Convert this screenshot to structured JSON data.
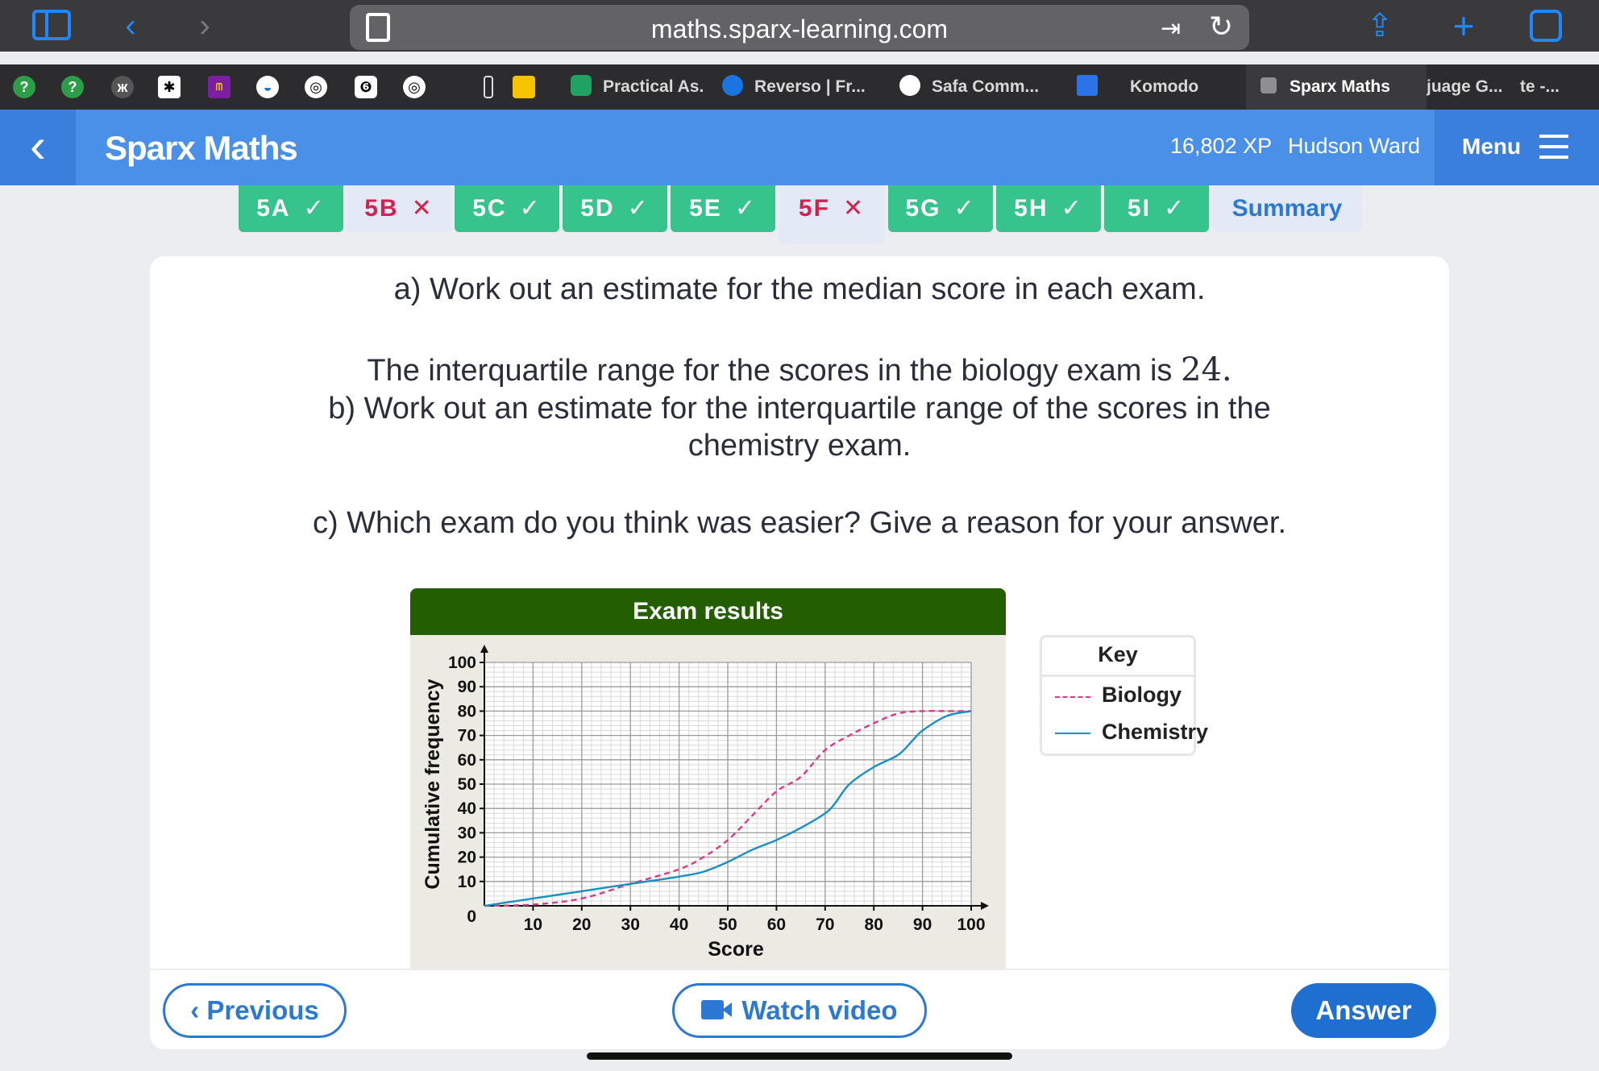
{
  "browser": {
    "url": "maths.sparx-learning.com",
    "tabs": [
      {
        "label": "Practical As."
      },
      {
        "label": "Reverso | Fr..."
      },
      {
        "label": "Safa Comm..."
      },
      {
        "label": "Komodo"
      },
      {
        "label": "Sparx Maths",
        "active": true
      },
      {
        "label": "juage G..."
      },
      {
        "label": "te -..."
      }
    ]
  },
  "header": {
    "title": "Sparx Maths",
    "xp": "16,802 XP",
    "user": "Hudson Ward",
    "menu_label": "Menu"
  },
  "task_tabs": [
    {
      "label": "5A",
      "mark": "✓",
      "status": "done"
    },
    {
      "label": "5B",
      "mark": "✕",
      "status": "fail"
    },
    {
      "label": "5C",
      "mark": "✓",
      "status": "done"
    },
    {
      "label": "5D",
      "mark": "✓",
      "status": "done"
    },
    {
      "label": "5E",
      "mark": "✓",
      "status": "done"
    },
    {
      "label": "5F",
      "mark": "✕",
      "status": "current"
    },
    {
      "label": "5G",
      "mark": "✓",
      "status": "done"
    },
    {
      "label": "5H",
      "mark": "✓",
      "status": "done"
    },
    {
      "label": "5I",
      "mark": "✓",
      "status": "done"
    },
    {
      "label": "Summary",
      "mark": "",
      "status": "summary"
    }
  ],
  "question": {
    "part_a": "a) Work out an estimate for the median score in each exam.",
    "iqr_prefix": "The interquartile range for the scores in the biology exam is ",
    "iqr_value": "24.",
    "part_b_line1": "b) Work out an estimate for the interquartile range of the scores in the",
    "part_b_line2": "chemistry exam.",
    "part_c": "c) Which exam do you think was easier? Give a reason for your answer."
  },
  "key": {
    "title": "Key",
    "items": [
      {
        "label": "Biology",
        "color": "#e0378a",
        "style": "dashed"
      },
      {
        "label": "Chemistry",
        "color": "#1a8fc0",
        "style": "solid"
      }
    ]
  },
  "chart_data": {
    "type": "line",
    "title": "Exam results",
    "xlabel": "Score",
    "ylabel": "Cumulative frequency",
    "xlim": [
      0,
      100
    ],
    "ylim": [
      0,
      100
    ],
    "x_ticks": [
      10,
      20,
      30,
      40,
      50,
      60,
      70,
      80,
      90,
      100
    ],
    "y_ticks": [
      10,
      20,
      30,
      40,
      50,
      60,
      70,
      80,
      90,
      100
    ],
    "origin_label": "0",
    "grid": true,
    "series": [
      {
        "name": "Biology",
        "color": "#e0378a",
        "style": "dashed",
        "points": [
          [
            0,
            0
          ],
          [
            10,
            0.5
          ],
          [
            20,
            3
          ],
          [
            30,
            9
          ],
          [
            40,
            15
          ],
          [
            45,
            20
          ],
          [
            50,
            27
          ],
          [
            55,
            37
          ],
          [
            60,
            47
          ],
          [
            65,
            53
          ],
          [
            70,
            64
          ],
          [
            75,
            70
          ],
          [
            80,
            75
          ],
          [
            85,
            79
          ],
          [
            90,
            80
          ],
          [
            95,
            80
          ],
          [
            100,
            80
          ]
        ]
      },
      {
        "name": "Chemistry",
        "color": "#1a8fc0",
        "style": "solid",
        "points": [
          [
            0,
            0
          ],
          [
            10,
            3
          ],
          [
            20,
            6
          ],
          [
            30,
            9
          ],
          [
            40,
            12
          ],
          [
            45,
            14
          ],
          [
            50,
            18
          ],
          [
            55,
            23
          ],
          [
            60,
            27
          ],
          [
            65,
            32
          ],
          [
            70,
            38
          ],
          [
            72,
            42
          ],
          [
            75,
            50
          ],
          [
            80,
            57
          ],
          [
            85,
            62
          ],
          [
            88,
            68
          ],
          [
            90,
            72
          ],
          [
            95,
            78
          ],
          [
            100,
            80
          ]
        ]
      }
    ]
  },
  "footer": {
    "previous": "Previous",
    "watch": "Watch video",
    "answer": "Answer"
  }
}
